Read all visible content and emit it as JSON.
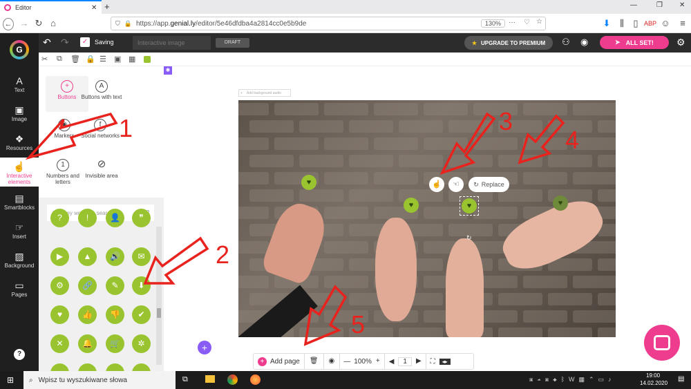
{
  "browser": {
    "tab_title": "Editor",
    "url_prefix": "https://app.",
    "url_domain": "genial.ly",
    "url_rest": "/editor/5e46dfdba4a2814cc0e5b9de",
    "zoom": "130%"
  },
  "app": {
    "saving_label": "Saving",
    "doc_name_placeholder": "Interactive image",
    "draft_label": "DRAFT",
    "upgrade_label": "UPGRADE TO PREMIUM",
    "allset_label": "ALL SET!"
  },
  "leftnav": {
    "items": [
      {
        "label": "Text",
        "icon": "A"
      },
      {
        "label": "Image",
        "icon": "▣"
      },
      {
        "label": "Resources",
        "icon": "❖"
      },
      {
        "label": "Interactive elements",
        "icon": "☝"
      },
      {
        "label": "Smartblocks",
        "icon": "▤"
      },
      {
        "label": "Insert",
        "icon": "☞"
      },
      {
        "label": "Background",
        "icon": "▨"
      },
      {
        "label": "Pages",
        "icon": "▭"
      }
    ]
  },
  "panel": {
    "types": [
      {
        "label": "Buttons",
        "icon": "+"
      },
      {
        "label": "Buttons with text",
        "icon": "A"
      },
      {
        "label": "Markers",
        "icon": "◉"
      },
      {
        "label": "Social networks",
        "icon": "f"
      },
      {
        "label": "Numbers and letters",
        "icon": "1"
      },
      {
        "label": "Invisible area",
        "icon": "⊘"
      }
    ],
    "search_placeholder": "Use key words to search",
    "icons": [
      "?",
      "!",
      "👤",
      "❞",
      "▶",
      "▲",
      "🔊",
      "✉",
      "⚙",
      "🔗",
      "✎",
      "⬇",
      "♥",
      "👍",
      "👎",
      "✔",
      "✕",
      "🔔",
      "🛒",
      "✲",
      "",
      "",
      "",
      ""
    ]
  },
  "canvas": {
    "add_background_audio": "Add background audio",
    "replace_label": "Replace",
    "heart_icon": "♥"
  },
  "annotations": [
    "1",
    "2",
    "3",
    "4",
    "5"
  ],
  "bottombar": {
    "add_page_label": "Add page",
    "zoom": "100%",
    "page_number": "1"
  },
  "taskbar": {
    "search_placeholder": "Wpisz tu wyszukiwane słowa",
    "time": "19:00",
    "date": "14.02.2020"
  },
  "colors": {
    "accent_pink": "#ee3d8f",
    "button_green": "#9ac42f",
    "annotation_red": "#e8221d"
  }
}
